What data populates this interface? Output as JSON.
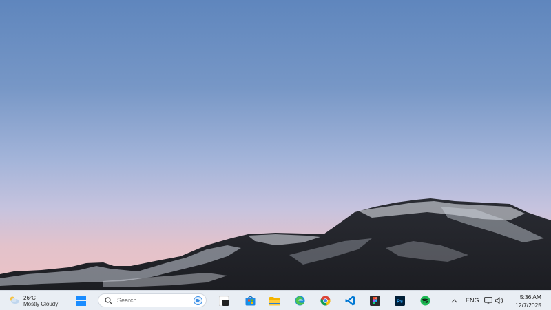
{
  "weather": {
    "temperature": "26°C",
    "condition": "Mostly Cloudy",
    "icon": "partly-cloudy-icon"
  },
  "search": {
    "placeholder": "Search"
  },
  "taskbar_apps": [
    {
      "name": "Start",
      "icon": "windows-logo-icon"
    },
    {
      "name": "Task View",
      "icon": "task-view-icon"
    },
    {
      "name": "Microsoft Store",
      "icon": "store-icon"
    },
    {
      "name": "File Explorer",
      "icon": "folder-icon"
    },
    {
      "name": "Microsoft Edge",
      "icon": "edge-icon"
    },
    {
      "name": "Google Chrome",
      "icon": "chrome-icon"
    },
    {
      "name": "Visual Studio Code",
      "icon": "vscode-icon"
    },
    {
      "name": "Figma",
      "icon": "figma-icon"
    },
    {
      "name": "Photoshop",
      "icon": "photoshop-icon",
      "label": "Ps"
    },
    {
      "name": "Spotify",
      "icon": "spotify-icon"
    }
  ],
  "tray": {
    "language": "ENG",
    "time": "5:36 AM",
    "date": "12/7/2025"
  },
  "colors": {
    "taskbar_bg": "#e9eef4",
    "start_blue": "#1a8cff",
    "photoshop_bg": "#001e36",
    "photoshop_text": "#31a8ff",
    "spotify_green": "#1db954",
    "vscode_blue": "#0078d4"
  }
}
